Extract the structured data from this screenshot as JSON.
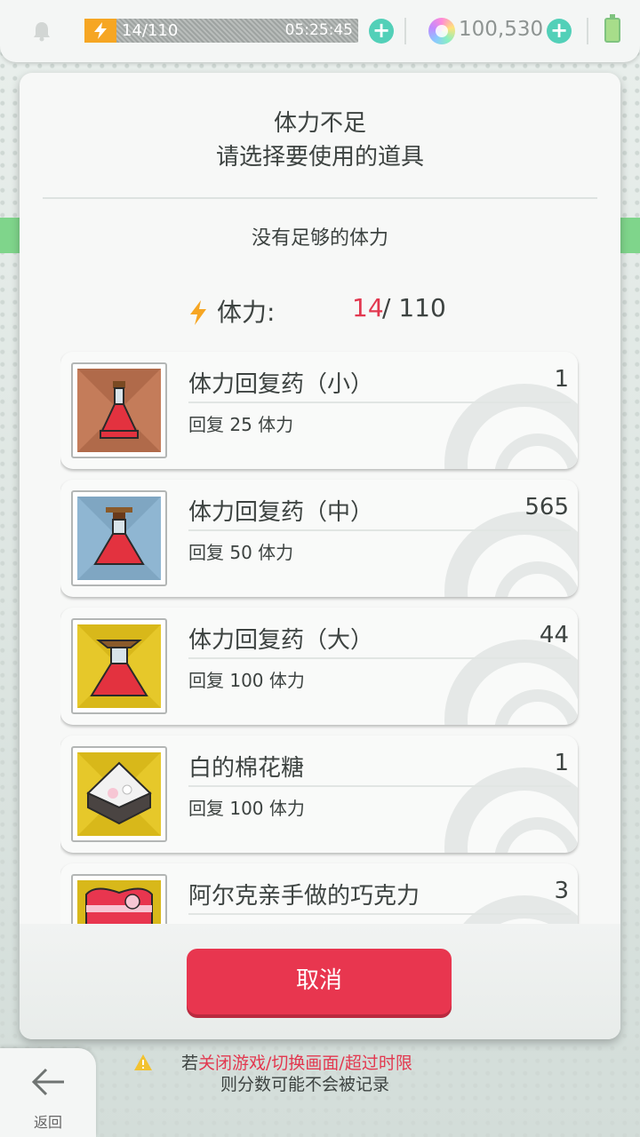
{
  "status_bar": {
    "stamina_value": "14/110",
    "stamina_timer": "05:25:45",
    "gem_count": "100,530"
  },
  "dialog": {
    "title_line1": "体力不足",
    "title_line2": "请选择要使用的道具",
    "notice": "没有足够的体力",
    "stamina_label": "体力:",
    "stamina_current": "14",
    "stamina_max": "/ 110",
    "items": [
      {
        "name": "体力回复药（小）",
        "count": "1",
        "desc": "回复 25 体力"
      },
      {
        "name": "体力回复药（中）",
        "count": "565",
        "desc": "回复 50 体力"
      },
      {
        "name": "体力回复药（大）",
        "count": "44",
        "desc": "回复 100 体力"
      },
      {
        "name": "白的棉花糖",
        "count": "1",
        "desc": "回复 100 体力"
      },
      {
        "name": "阿尔克亲手做的巧克力",
        "count": "3",
        "desc": ""
      }
    ],
    "cancel_label": "取消"
  },
  "footer": {
    "back_label": "返回",
    "warning_prefix": "若",
    "warning_highlight": "关闭游戏/切换画面/超过时限",
    "warning_line2": "则分数可能不会被记录"
  },
  "colors": {
    "accent_red": "#e8364f",
    "plus_teal": "#52d0b8",
    "bolt_orange": "#f6a623"
  }
}
